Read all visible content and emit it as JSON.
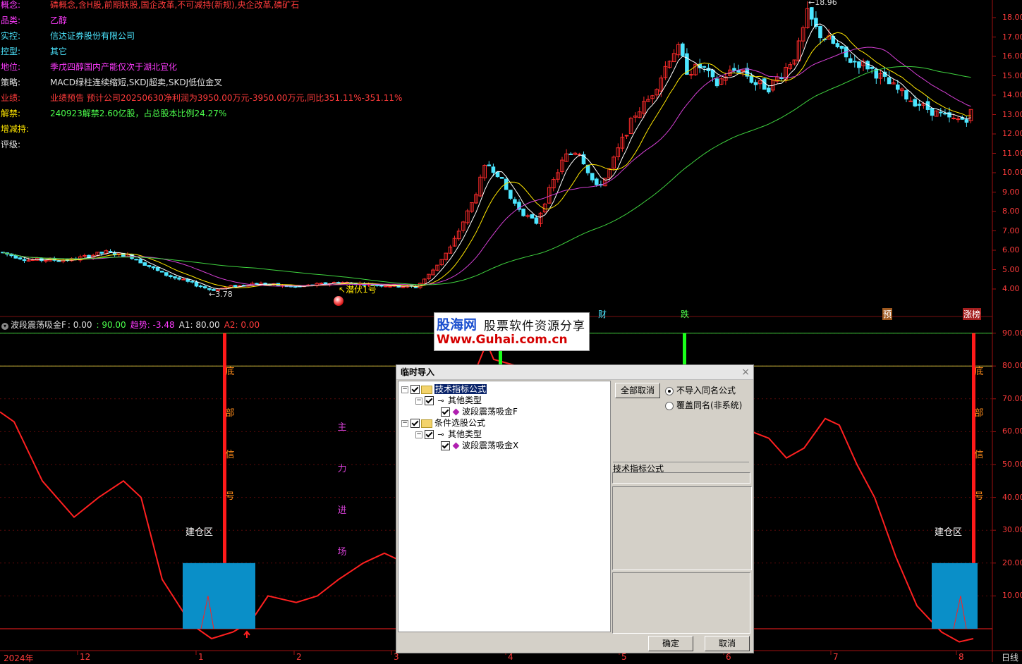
{
  "info_panel": [
    {
      "key": "概念:",
      "value": "磷概念,含H股,前期妖股,国企改革,不可减持(新规),央企改革,磷矿石",
      "key_color": "#ff3bff",
      "value_color": "#ff3b3b"
    },
    {
      "key": "品类:",
      "value": "乙醇",
      "key_color": "#ff3bff",
      "value_color": "#ff3bff"
    },
    {
      "key": "实控:",
      "value": "信达证券股份有限公司",
      "key_color": "#4ce6ff",
      "value_color": "#4ce6ff"
    },
    {
      "key": "控型:",
      "value": "其它",
      "key_color": "#4ce6ff",
      "value_color": "#4ce6ff"
    },
    {
      "key": "地位:",
      "value": "季戊四醇国内产能仅次于湖北宜化",
      "key_color": "#ff3bff",
      "value_color": "#ff3bff"
    },
    {
      "key": "策略:",
      "value": "MACD绿柱连续缩短,SKDJ超卖,SKDJ低位金叉",
      "key_color": "#e0e0e0",
      "value_color": "#e0e0e0"
    },
    {
      "key": "业绩:",
      "value": "业绩预告 预计公司20250630净利润为3950.00万元-3950.00万元,同比351.11%-351.11%",
      "key_color": "#ff3b3b",
      "value_color": "#ff3b3b"
    },
    {
      "key": "解禁:",
      "value": "240923解禁2.60亿股，占总股本比例24.27%",
      "key_color": "#ffe600",
      "value_color": "#4cff4c"
    },
    {
      "key": "增减持:",
      "value": "",
      "key_color": "#ffe600",
      "value_color": "#ffe600"
    },
    {
      "key": "评级:",
      "value": "",
      "key_color": "#e0e0e0",
      "value_color": "#e0e0e0"
    }
  ],
  "main_chart": {
    "price_axis_labels": [
      "18.00",
      "17.00",
      "16.00",
      "15.00",
      "14.00",
      "13.00",
      "12.00",
      "11.00",
      "10.00",
      "9.00",
      "8.00",
      "7.00",
      "6.00",
      "5.00",
      "4.00"
    ],
    "high_marker": "18.96",
    "low_marker": "3.78",
    "annotation": "潜伏1号",
    "event_tags": [
      "财",
      "跌",
      "预",
      "涨榜"
    ]
  },
  "indicator": {
    "header_name": "波段震荡吸金F",
    "header_values": [
      {
        "text": ": 0.00",
        "color": "#e0e0e0"
      },
      {
        "text": ": 90.00",
        "color": "#4cff4c"
      },
      {
        "text": "趋势: -3.48",
        "color": "#ff3bff"
      },
      {
        "text": "A1: 80.00",
        "color": "#e0e0e0"
      },
      {
        "text": "A2: 0.00",
        "color": "#ff3b3b"
      }
    ],
    "axis_labels": [
      "90.00",
      "80.00",
      "70.00",
      "60.00",
      "50.00",
      "40.00",
      "30.00",
      "20.00",
      "10.00"
    ],
    "signal_chars": [
      "底",
      "部",
      "信",
      "号"
    ],
    "mainforce_chars": [
      "主",
      "力",
      "进",
      "场"
    ],
    "build_zone_label": "建仓区"
  },
  "time_axis": {
    "labels": [
      "2024年",
      "12",
      "1",
      "2",
      "3",
      "4",
      "5",
      "6",
      "7",
      "8"
    ],
    "period": "日线"
  },
  "watermark": {
    "brand": "股海网",
    "tagline": "股票软件资源分享",
    "url": "Www.Guhai.com.cn"
  },
  "dialog": {
    "title": "临时导入",
    "close_icon": "×",
    "tree": [
      {
        "label": "技术指标公式",
        "level": 0,
        "type": "folder",
        "selected": true
      },
      {
        "label": "其他类型",
        "level": 1,
        "type": "key"
      },
      {
        "label": "波段震荡吸金F",
        "level": 2,
        "type": "formula"
      },
      {
        "label": "条件选股公式",
        "level": 0,
        "type": "folder",
        "selected": false
      },
      {
        "label": "其他类型",
        "level": 1,
        "type": "key"
      },
      {
        "label": "波段震荡吸金X",
        "level": 2,
        "type": "formula"
      }
    ],
    "cancel_all_label": "全部取消",
    "radio_options": [
      {
        "label": "不导入同名公式",
        "checked": true
      },
      {
        "label": "覆盖同名(非系统)",
        "checked": false
      }
    ],
    "category_text": "技术指标公式",
    "ok_label": "确定",
    "cancel_label": "取消"
  },
  "colors": {
    "up": "#ff2b2b",
    "down": "#4ce6ff",
    "ma_white": "#ffffff",
    "ma_yellow": "#ffe600",
    "ma_magenta": "#d43fd4",
    "ma_green": "#3fd43f",
    "osc_line": "#ff2020",
    "zone_fill": "#0a8fc8"
  }
}
